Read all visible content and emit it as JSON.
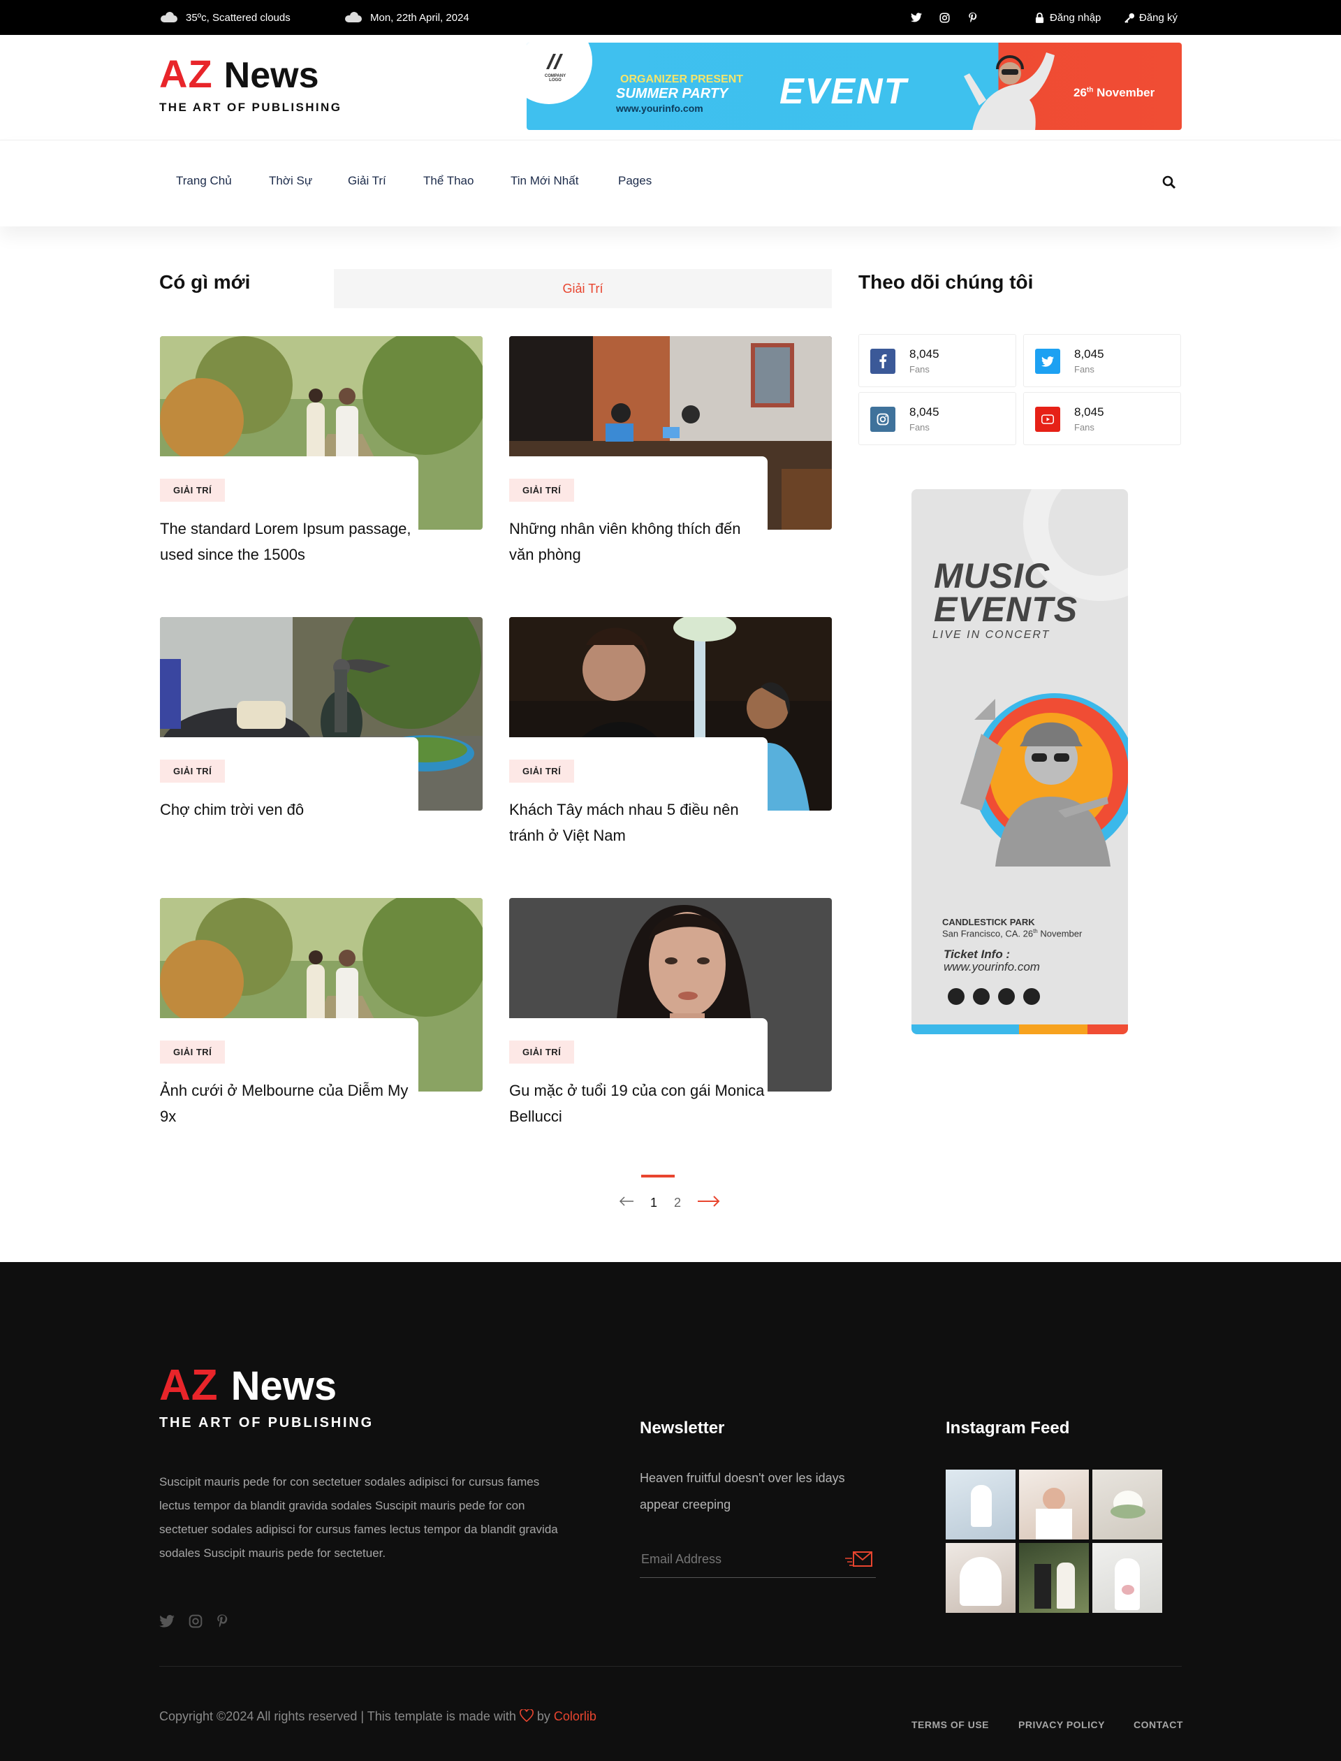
{
  "topbar": {
    "weather": "35ºc, Scattered clouds",
    "date": "Mon, 22th April, 2024",
    "login": "Đăng nhập",
    "register": "Đăng ký"
  },
  "header": {
    "logo_az": "AZ",
    "logo_news": "News",
    "logo_tagline": "THE ART OF PUBLISHING"
  },
  "banner": {
    "company_logo": "COMPANY LOGO",
    "organizer": "ORGANIZER PRESENT",
    "party": "SUMMER PARTY",
    "url": "www.yourinfo.com",
    "event": "EVENT",
    "date_day": "26",
    "date_suffix": "th",
    "date_month": "November"
  },
  "nav": {
    "items": [
      "Trang Chủ",
      "Thời Sự",
      "Giải Trí",
      "Thể Thao",
      "Tin Mới Nhất",
      "Pages"
    ]
  },
  "main": {
    "section_title": "Có gì mới",
    "active_tab": "Giải Trí",
    "cards": [
      {
        "badge": "GIẢI TRÍ",
        "title": "The standard Lorem Ipsum passage, used since the 1500s"
      },
      {
        "badge": "GIẢI TRÍ",
        "title": "Những nhân viên không thích đến văn phòng"
      },
      {
        "badge": "GIẢI TRÍ",
        "title": "Chợ chim trời ven đô"
      },
      {
        "badge": "GIẢI TRÍ",
        "title": "Khách Tây mách nhau 5 điều nên tránh ở Việt Nam"
      },
      {
        "badge": "GIẢI TRÍ",
        "title": "Ảnh cưới ở Melbourne của Diễm My 9x"
      },
      {
        "badge": "GIẢI TRÍ",
        "title": "Gu mặc ở tuổi 19 của con gái Monica Bellucci"
      }
    ],
    "pagination": {
      "page1": "1",
      "page2": "2"
    }
  },
  "sidebar": {
    "title": "Theo dõi chúng tôi",
    "follows": [
      {
        "network": "facebook",
        "count": "8,045",
        "label": "Fans",
        "color": "#3b5998"
      },
      {
        "network": "twitter",
        "count": "8,045",
        "label": "Fans",
        "color": "#1da1f2"
      },
      {
        "network": "instagram",
        "count": "8,045",
        "label": "Fans",
        "color": "#3f729b"
      },
      {
        "network": "youtube",
        "count": "8,045",
        "label": "Fans",
        "color": "#e62117"
      }
    ],
    "ad": {
      "line1": "MUSIC",
      "line2": "EVENTS",
      "line3": "LIVE IN CONCERT",
      "venue": "CANDLESTICK PARK",
      "venue_place": "San Francisco, CA. 26",
      "venue_suffix": "th",
      "venue_month": " November",
      "ticket_label": "Ticket Info :",
      "ticket_url": "www.yourinfo.com"
    }
  },
  "footer": {
    "about": "Suscipit mauris pede for con sectetuer sodales adipisci for cursus fames lectus tempor da blandit gravida sodales Suscipit mauris pede for con sectetuer sodales adipisci for cursus fames lectus tempor da blandit gravida sodales Suscipit mauris pede for sectetuer.",
    "newsletter_title": "Newsletter",
    "newsletter_text": "Heaven fruitful doesn't over les idays appear creeping",
    "email_placeholder": "Email Address",
    "instagram_title": "Instagram Feed",
    "copyright_prefix": "Copyright ©2024 All rights reserved | This template is made with",
    "copyright_by": "by",
    "copyright_brand": "Colorlib",
    "links": [
      "TERMS OF USE",
      "PRIVACY POLICY",
      "CONTACT"
    ]
  },
  "colors": {
    "accent": "#e8452f",
    "footer_bg": "#0f0f0f",
    "badge_bg": "#fde8e6"
  }
}
